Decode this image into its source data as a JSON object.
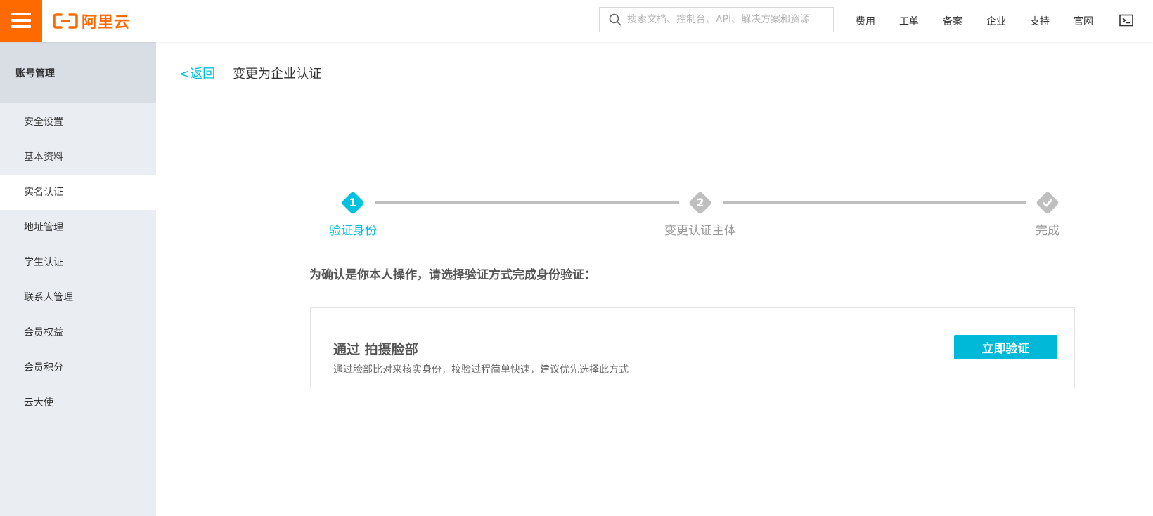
{
  "colors": {
    "brand_orange": "#ff6a00",
    "accent_cyan": "#00c1de",
    "sidebar_bg": "#eaedf1",
    "sidebar_header_bg": "#d9dee4",
    "step_inactive": "#bfbfbf"
  },
  "header": {
    "menu_icon": "hamburger-icon",
    "logo_text": "阿里云",
    "search": {
      "icon": "search-icon",
      "placeholder": "搜索文档、控制台、API、解决方案和资源",
      "value": ""
    },
    "nav": [
      "费用",
      "工单",
      "备案",
      "企业",
      "支持",
      "官网"
    ],
    "terminal_icon": "terminal-icon"
  },
  "sidebar": {
    "title": "账号管理",
    "items": [
      {
        "label": "安全设置",
        "active": false
      },
      {
        "label": "基本资料",
        "active": false
      },
      {
        "label": "实名认证",
        "active": true
      },
      {
        "label": "地址管理",
        "active": false
      },
      {
        "label": "学生认证",
        "active": false
      },
      {
        "label": "联系人管理",
        "active": false
      },
      {
        "label": "会员权益",
        "active": false
      },
      {
        "label": "会员积分",
        "active": false
      },
      {
        "label": "云大使",
        "active": false
      }
    ]
  },
  "main": {
    "back_label": "<返回",
    "title": "变更为企业认证",
    "steps": [
      {
        "marker": "1",
        "label": "验证身份",
        "state": "active"
      },
      {
        "marker": "2",
        "label": "变更认证主体",
        "state": "pending"
      },
      {
        "marker": "check-icon",
        "label": "完成",
        "state": "pending"
      }
    ],
    "prompt": "为确认是你本人操作，请选择验证方式完成身份验证：",
    "method": {
      "title": "通过 拍摄脸部",
      "description": "通过脸部比对来核实身份，校验过程简单快速，建议优先选择此方式",
      "button_label": "立即验证"
    }
  }
}
